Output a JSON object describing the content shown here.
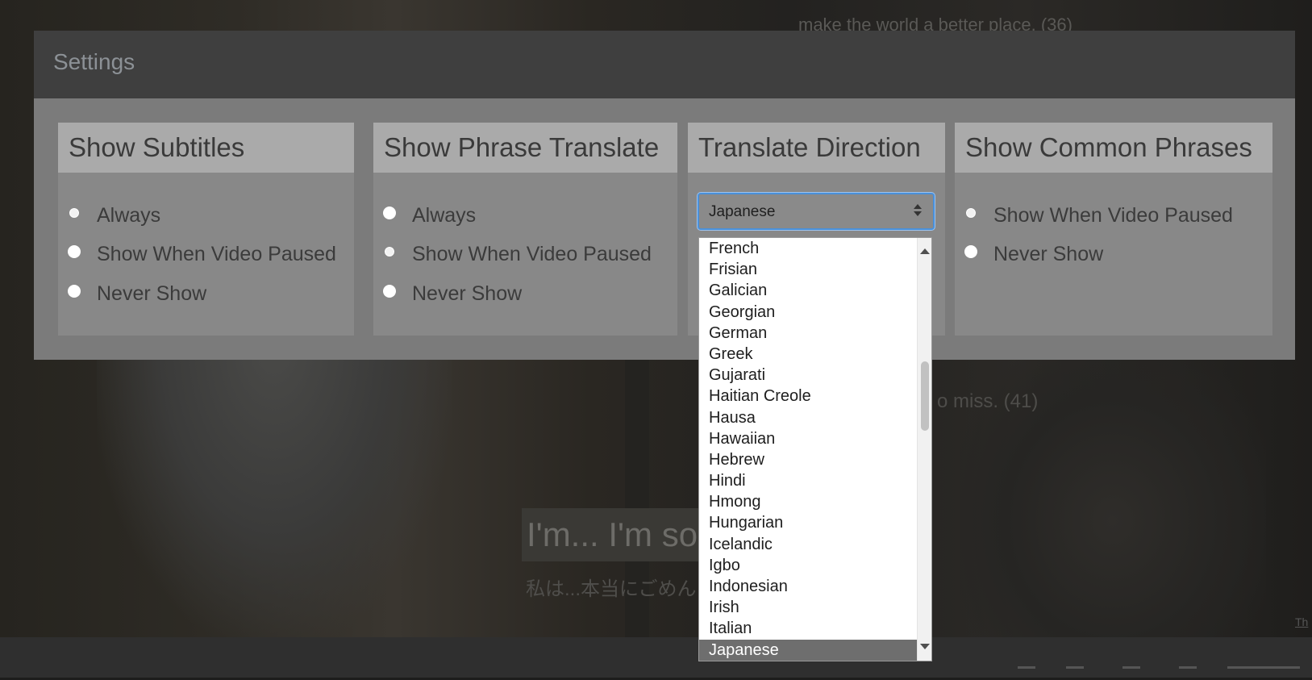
{
  "background": {
    "caption_top": "make the world a better place. (36)",
    "caption_mid": "o miss. (41)",
    "subtitle_main": "I'm... I'm so",
    "subtitle_translation": "私は...本当にごめん",
    "link_text": "Th"
  },
  "settings": {
    "title": "Settings",
    "panels": [
      {
        "title": "Show Subtitles",
        "options": [
          {
            "label": "Always",
            "selected": true
          },
          {
            "label": "Show When Video Paused",
            "selected": false
          },
          {
            "label": "Never Show",
            "selected": false
          }
        ]
      },
      {
        "title": "Show Phrase Translate",
        "options": [
          {
            "label": "Always",
            "selected": false
          },
          {
            "label": "Show When Video Paused",
            "selected": true
          },
          {
            "label": "Never Show",
            "selected": false
          }
        ]
      },
      {
        "title": "Translate Direction",
        "select_value": "Japanese"
      },
      {
        "title": "Show Common Phrases",
        "options": [
          {
            "label": "Show When Video Paused",
            "selected": true
          },
          {
            "label": "Never Show",
            "selected": false
          }
        ]
      }
    ]
  },
  "dropdown": {
    "items": [
      "French",
      "Frisian",
      "Galician",
      "Georgian",
      "German",
      "Greek",
      "Gujarati",
      "Haitian Creole",
      "Hausa",
      "Hawaiian",
      "Hebrew",
      "Hindi",
      "Hmong",
      "Hungarian",
      "Icelandic",
      "Igbo",
      "Indonesian",
      "Irish",
      "Italian",
      "Japanese"
    ],
    "selected": "Japanese"
  },
  "colors": {
    "accent": "#4a90d9",
    "modal_header": "#3f3f3f",
    "modal_body": "#7b7b7b",
    "panel_head": "#aaaaaa",
    "selected_item": "#6e6e6e"
  }
}
